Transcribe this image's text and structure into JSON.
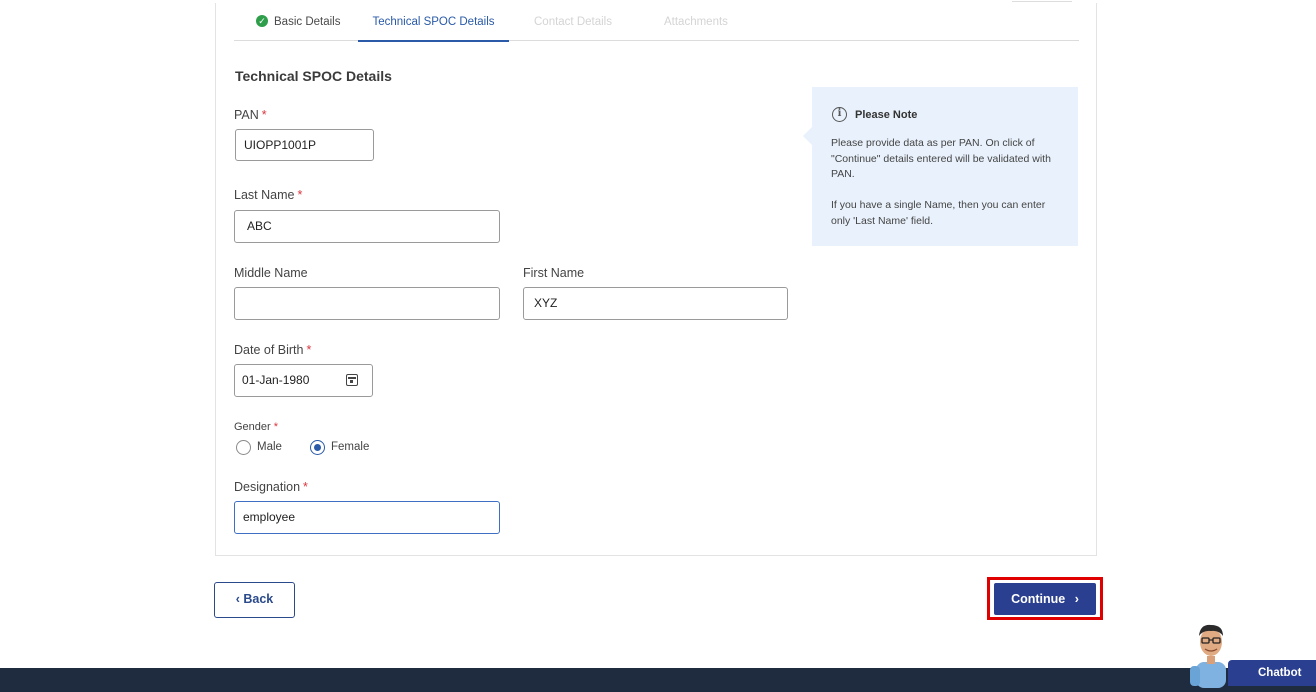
{
  "tabs": [
    {
      "label": "Basic Details",
      "state": "completed"
    },
    {
      "label": "Technical SPOC Details",
      "state": "active"
    },
    {
      "label": "Contact Details",
      "state": "disabled"
    },
    {
      "label": "Attachments",
      "state": "disabled"
    }
  ],
  "section_title": "Technical SPOC Details",
  "form": {
    "pan": {
      "label": "PAN",
      "required": "*",
      "value": "UIOPP1001P"
    },
    "last_name": {
      "label": "Last Name",
      "required": "*",
      "value": "ABC"
    },
    "middle_name": {
      "label": "Middle Name",
      "value": ""
    },
    "first_name": {
      "label": "First Name",
      "value": "XYZ"
    },
    "dob": {
      "label": "Date of Birth",
      "required": "*",
      "value": "01-Jan-1980"
    },
    "gender": {
      "label": "Gender",
      "required": "*",
      "options": [
        "Male",
        "Female"
      ],
      "selected": "Female"
    },
    "designation": {
      "label": "Designation",
      "required": "*",
      "value": "employee"
    }
  },
  "note": {
    "title": "Please Note",
    "para1": "Please provide data as per PAN. On click of \"Continue\" details entered will be validated with PAN.",
    "para2": "If you have a single Name, then you can enter only 'Last Name' field."
  },
  "buttons": {
    "back": "Back",
    "continue": "Continue",
    "back_icon": "‹",
    "continue_icon": "›"
  },
  "chatbot": {
    "label": "Chatbot"
  },
  "colors": {
    "accent": "#2a5aa8",
    "button": "#2a3f8f",
    "success": "#2e9e4b",
    "highlight": "#e10000",
    "footer": "#1f2c3f",
    "note_bg": "#e9f2fc"
  }
}
